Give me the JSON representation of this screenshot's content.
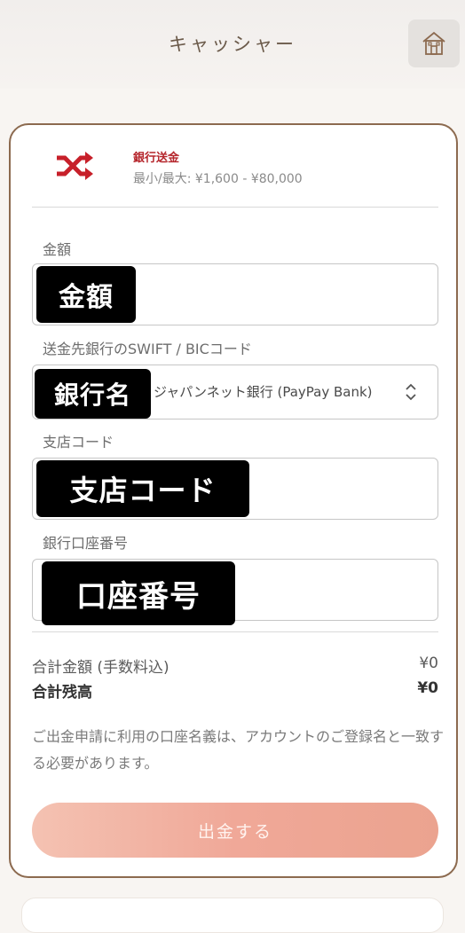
{
  "header": {
    "title": "キャッシャー",
    "home_icon": "home-icon"
  },
  "method": {
    "icon": "shuffle-icon",
    "name": "銀行送金",
    "range": "最小/最大: ¥1,600 - ¥80,000",
    "accent_color": "#b5252b"
  },
  "form": {
    "amount": {
      "label": "金額",
      "overlay": "金額",
      "value": ""
    },
    "bank": {
      "label": "送金先銀行のSWIFT / BICコード",
      "overlay": "銀行名",
      "selected": "ジャパンネット銀行 (PayPay Bank)"
    },
    "branch": {
      "label": "支店コード",
      "overlay": "支店コード",
      "value": ""
    },
    "account": {
      "label": "銀行口座番号",
      "overlay": "口座番号",
      "value": ""
    }
  },
  "summary": {
    "total_label": "合計金額 (手数料込)",
    "total_value": "¥0",
    "balance_label": "合計残高",
    "balance_value": "¥0"
  },
  "note": "ご出金申請に利用の口座名義は、アカウントのご登録名と一致する必要があります。",
  "submit_label": "出金する",
  "colors": {
    "card_border": "#8c6a4f",
    "submit_start": "#f4c2b2",
    "submit_end": "#eba38f"
  }
}
